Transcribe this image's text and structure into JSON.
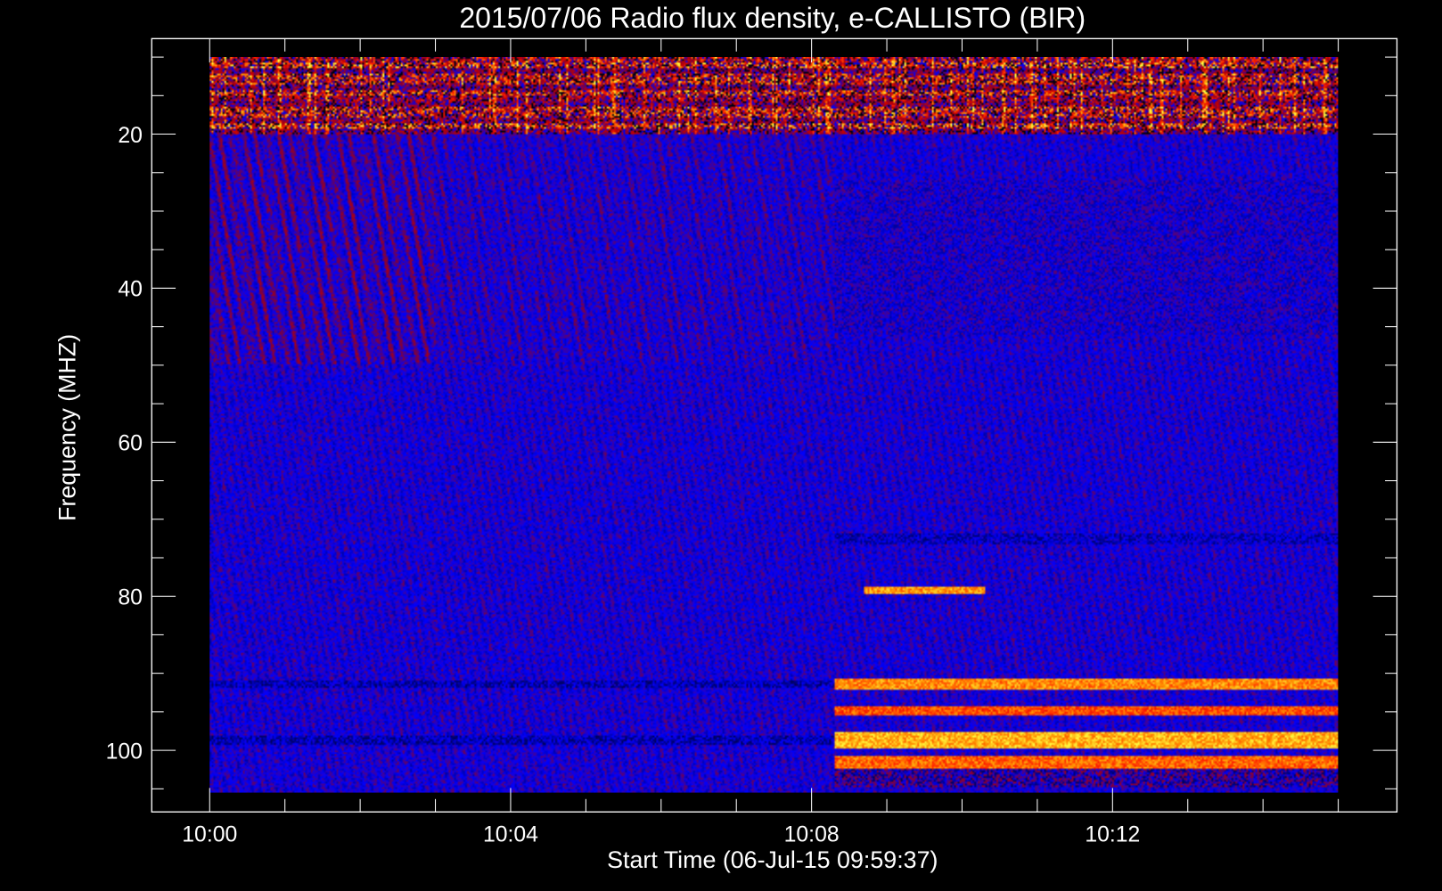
{
  "chart_data": {
    "type": "heatmap",
    "title": "2015/07/06  Radio flux density, e-CALLISTO (BIR)",
    "xlabel": "Start Time (06-Jul-15 09:59:37)",
    "ylabel": "Frequency (MHZ)",
    "x_units": "minutes after 10:00 UT",
    "xlim": [
      -0.77,
      15.78
    ],
    "data_x_range": [
      0,
      15
    ],
    "ylim": [
      108,
      7.6
    ],
    "data_y_range": [
      10,
      105.6
    ],
    "y_inverted": true,
    "xticks": [
      {
        "value": 0,
        "label": "10:00"
      },
      {
        "value": 4,
        "label": "10:04"
      },
      {
        "value": 8,
        "label": "10:08"
      },
      {
        "value": 12,
        "label": "10:12"
      }
    ],
    "x_minor_step": 1,
    "yticks": [
      {
        "value": 20,
        "label": "20"
      },
      {
        "value": 40,
        "label": "40"
      },
      {
        "value": 60,
        "label": "60"
      },
      {
        "value": 80,
        "label": "80"
      },
      {
        "value": 100,
        "label": "100"
      }
    ],
    "y_minor_step": 5,
    "colormap": [
      "#000000",
      "#00007a",
      "#0000ff",
      "#7a0040",
      "#c00000",
      "#ff2000",
      "#ff9000",
      "#ffff40"
    ],
    "features": [
      {
        "name": "interference-top",
        "f": [
          10,
          20
        ],
        "t": [
          0,
          15
        ],
        "level": 0.75
      },
      {
        "name": "dark-band-after",
        "f": [
          26,
          46
        ],
        "t": [
          8.3,
          15
        ],
        "level": 0.18
      },
      {
        "name": "dark-line",
        "f": [
          72,
          73.3
        ],
        "t": [
          8.3,
          15
        ],
        "level": 0.12
      },
      {
        "name": "burst-80",
        "f": [
          78.8,
          79.8
        ],
        "t": [
          8.7,
          10.3
        ],
        "level": 0.92
      },
      {
        "name": "band-91",
        "f": [
          90.8,
          92.3
        ],
        "t": [
          8.3,
          15
        ],
        "level": 0.9
      },
      {
        "name": "band-95",
        "f": [
          94.4,
          95.6
        ],
        "t": [
          8.3,
          15
        ],
        "level": 0.82
      },
      {
        "name": "band-99",
        "f": [
          97.8,
          99.8
        ],
        "t": [
          8.3,
          15
        ],
        "level": 0.95
      },
      {
        "name": "band-102",
        "f": [
          100.8,
          103
        ],
        "t": [
          8.3,
          15
        ],
        "level": 0.85
      },
      {
        "name": "dark-91-before",
        "f": [
          91,
          92
        ],
        "t": [
          0,
          8.3
        ],
        "level": 0.1
      },
      {
        "name": "dark-99-before",
        "f": [
          98.2,
          99.5
        ],
        "t": [
          0,
          8.3
        ],
        "level": 0.1
      }
    ]
  }
}
